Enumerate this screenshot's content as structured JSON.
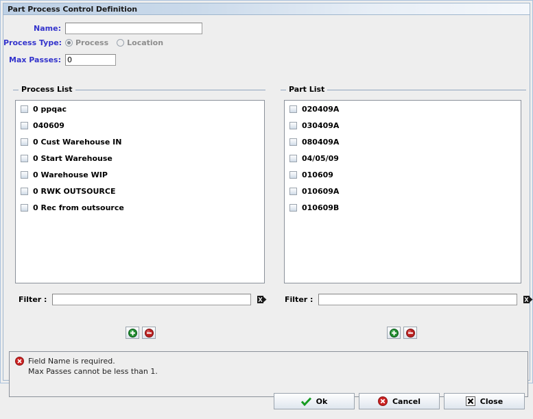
{
  "window": {
    "title": "Part Process Control Definition"
  },
  "form": {
    "name": {
      "label": "Name:",
      "value": "",
      "placeholder": ""
    },
    "process_type": {
      "label": "Process Type:",
      "options": [
        {
          "label": "Process",
          "selected": true
        },
        {
          "label": "Location",
          "selected": false
        }
      ]
    },
    "max_passes": {
      "label": "Max Passes:",
      "value": "0",
      "placeholder": ""
    }
  },
  "process_list": {
    "title": "Process List",
    "items": [
      {
        "label": "0 ppqac",
        "checked": false
      },
      {
        "label": "040609",
        "checked": false
      },
      {
        "label": "0 Cust Warehouse IN",
        "checked": false
      },
      {
        "label": "0 Start Warehouse",
        "checked": false
      },
      {
        "label": "0 Warehouse WIP",
        "checked": false
      },
      {
        "label": "0 RWK OUTSOURCE",
        "checked": false
      },
      {
        "label": "0 Rec from outsource",
        "checked": false
      }
    ],
    "filter": {
      "label": "Filter :",
      "value": "",
      "placeholder": ""
    }
  },
  "part_list": {
    "title": "Part List",
    "items": [
      {
        "label": "020409A",
        "checked": false
      },
      {
        "label": "030409A",
        "checked": false
      },
      {
        "label": "080409A",
        "checked": false
      },
      {
        "label": "04/05/09",
        "checked": false
      },
      {
        "label": "010609",
        "checked": false
      },
      {
        "label": "010609A",
        "checked": false
      },
      {
        "label": "010609B",
        "checked": false
      }
    ],
    "filter": {
      "label": "Filter :",
      "value": "",
      "placeholder": ""
    }
  },
  "errors": {
    "line1": "Field Name is required.",
    "line2": "Max Passes cannot be less than 1."
  },
  "buttons": {
    "ok": "Ok",
    "cancel": "Cancel",
    "close": "Close"
  },
  "icons": {
    "error": "error-circle-icon",
    "add": "add-circle-icon",
    "remove": "remove-circle-icon",
    "filter_exec": "filter-execute-icon",
    "ok": "check-icon",
    "cancel": "cancel-circle-icon",
    "close": "close-box-icon"
  },
  "colors": {
    "label_blue": "#3333cc",
    "disabled_gray": "#8d8d8d",
    "error_red": "#cc2222",
    "add_green": "#1f8a2e",
    "panel_bg": "#eeeeee",
    "title_bar": "#bdd0e5"
  }
}
